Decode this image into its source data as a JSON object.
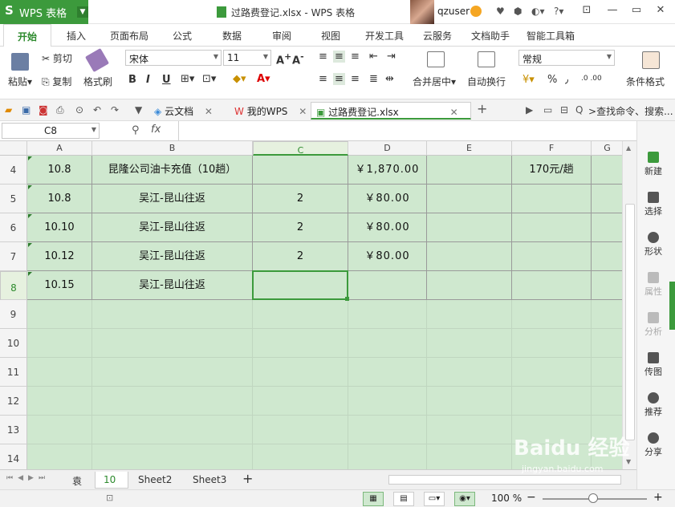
{
  "app": {
    "logo_s": "S",
    "name": "WPS 表格",
    "window_title": "过路费登记.xlsx - WPS 表格",
    "user": "qzuser"
  },
  "title_icons": {
    "a": "?",
    "b": "⊡",
    "c": "▭",
    "d": "✕"
  },
  "ribbon_tabs": [
    "开始",
    "插入",
    "页面布局",
    "公式",
    "数据",
    "审阅",
    "视图",
    "开发工具",
    "云服务",
    "文档助手",
    "智能工具箱"
  ],
  "ribbon": {
    "paste": "粘贴",
    "cut": "剪切",
    "copy": "复制",
    "format_painter": "格式刷",
    "font_name": "宋体",
    "font_size": "11",
    "bold": "B",
    "italic": "I",
    "underline": "U",
    "merge_center": "合并居中",
    "wrap_text": "自动换行",
    "number_format": "常规",
    "percent": "%",
    "comma": "٫",
    "inc_decimal": ".0 .00",
    "cond_format": "条件格式"
  },
  "doc_tabs": [
    "云文档",
    "我的WPS",
    "过路费登记.xlsx"
  ],
  "search_placeholder": "查找命令、搜索...",
  "formula_bar": {
    "cell_ref": "C8",
    "fx": "fx",
    "value": ""
  },
  "columns": [
    "A",
    "B",
    "C",
    "D",
    "E",
    "F",
    "G"
  ],
  "rows": [
    {
      "num": "4",
      "A": "10.8",
      "B": "昆隆公司油卡充值（10趟）",
      "C": "",
      "D": "￥1,870.00",
      "E": "",
      "F": "170元/趟"
    },
    {
      "num": "5",
      "A": "10.8",
      "B": "吴江-昆山往返",
      "C": "2",
      "D": "￥80.00",
      "E": "",
      "F": ""
    },
    {
      "num": "6",
      "A": "10.10",
      "B": "吴江-昆山往返",
      "C": "2",
      "D": "￥80.00",
      "E": "",
      "F": ""
    },
    {
      "num": "7",
      "A": "10.12",
      "B": "吴江-昆山往返",
      "C": "2",
      "D": "￥80.00",
      "E": "",
      "F": ""
    },
    {
      "num": "8",
      "A": "10.15",
      "B": "吴江-昆山往返",
      "C": "",
      "D": "",
      "E": "",
      "F": ""
    },
    {
      "num": "9",
      "A": "",
      "B": "",
      "C": "",
      "D": "",
      "E": "",
      "F": ""
    },
    {
      "num": "10",
      "A": "",
      "B": "",
      "C": "",
      "D": "",
      "E": "",
      "F": ""
    },
    {
      "num": "11",
      "A": "",
      "B": "",
      "C": "",
      "D": "",
      "E": "",
      "F": ""
    },
    {
      "num": "12",
      "A": "",
      "B": "",
      "C": "",
      "D": "",
      "E": "",
      "F": ""
    },
    {
      "num": "13",
      "A": "",
      "B": "",
      "C": "",
      "D": "",
      "E": "",
      "F": ""
    },
    {
      "num": "14",
      "A": "",
      "B": "",
      "C": "",
      "D": "",
      "E": "",
      "F": ""
    }
  ],
  "selected_row": "8",
  "selected_col": "C",
  "sheet_tabs": [
    "袁",
    "10",
    "Sheet2",
    "Sheet3"
  ],
  "active_sheet": "10",
  "add_sheet": "+",
  "sidebar": [
    "新建",
    "选择",
    "形状",
    "属性",
    "分析",
    "传图",
    "推荐",
    "分享"
  ],
  "status": {
    "zoom": "100 %",
    "minus": "−",
    "plus": "+"
  },
  "watermark": {
    "main": "Baidu 经验",
    "sub": "jingyan.baidu.com"
  }
}
